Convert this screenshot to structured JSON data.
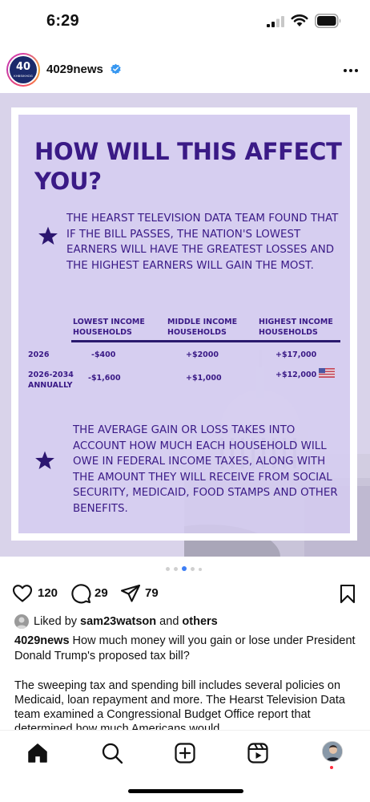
{
  "status_bar": {
    "time": "6:29"
  },
  "post": {
    "username": "4029news",
    "avatar": {
      "number": "40",
      "subtext": "KHBS/KHOG"
    },
    "image": {
      "headline": "HOW WILL THIS AFFECT YOU?",
      "paragraph1": "THE HEARST TELEVISION DATA TEAM FOUND THAT IF THE BILL PASSES, THE NATION'S LOWEST EARNERS WILL HAVE THE GREATEST LOSSES AND THE HIGHEST EARNERS WILL GAIN THE MOST.",
      "table": {
        "headers": [
          "LOWEST INCOME HOUSEHOLDS",
          "MIDDLE INCOME HOUSEHOLDS",
          "HIGHEST INCOME HOUSEHOLDS"
        ],
        "rows": [
          {
            "label": "2026",
            "values": [
              "-$400",
              "+$2000",
              "+$17,000"
            ]
          },
          {
            "label": "2026-2034 ANNUALLY",
            "values": [
              "-$1,600",
              "+$1,000",
              "+$12,000"
            ]
          }
        ]
      },
      "paragraph2": "THE AVERAGE GAIN OR LOSS TAKES INTO ACCOUNT HOW MUCH EACH HOUSEHOLD WILL OWE IN FEDERAL INCOME TAXES, ALONG WITH THE AMOUNT THEY WILL RECEIVE FROM SOCIAL SECURITY, MEDICAID, FOOD STAMPS AND OTHER BENEFITS."
    },
    "carousel": {
      "count": 5,
      "active_index": 2
    },
    "actions": {
      "likes": "120",
      "comments": "29",
      "shares": "79"
    },
    "liked_by": {
      "prefix": "Liked by ",
      "user": "sam23watson",
      "middle": " and ",
      "others": "others"
    },
    "caption": {
      "author": "4029news",
      "text": " How much money will you gain or lose under President Donald Trump's proposed tax bill?",
      "body": "The sweeping tax and spending bill includes several policies on Medicaid, loan repayment and more. The Hearst Television Data team examined a Congressional Budget Office report that determined how much Americans would"
    }
  },
  "colors": {
    "headline": "#3a1a86",
    "verified": "#3797f0",
    "active_dot": "#3d7ef5",
    "notification_dot": "#ff2e3e"
  },
  "icons": {
    "status": [
      "cellular-signal-icon",
      "wifi-icon",
      "battery-icon"
    ],
    "header": [
      "verified-badge-icon",
      "more-options-icon"
    ],
    "actions": [
      "heart-icon",
      "comment-icon",
      "share-icon",
      "bookmark-icon"
    ],
    "nav": [
      "home-icon",
      "search-icon",
      "create-icon",
      "reels-icon",
      "profile-avatar"
    ]
  }
}
